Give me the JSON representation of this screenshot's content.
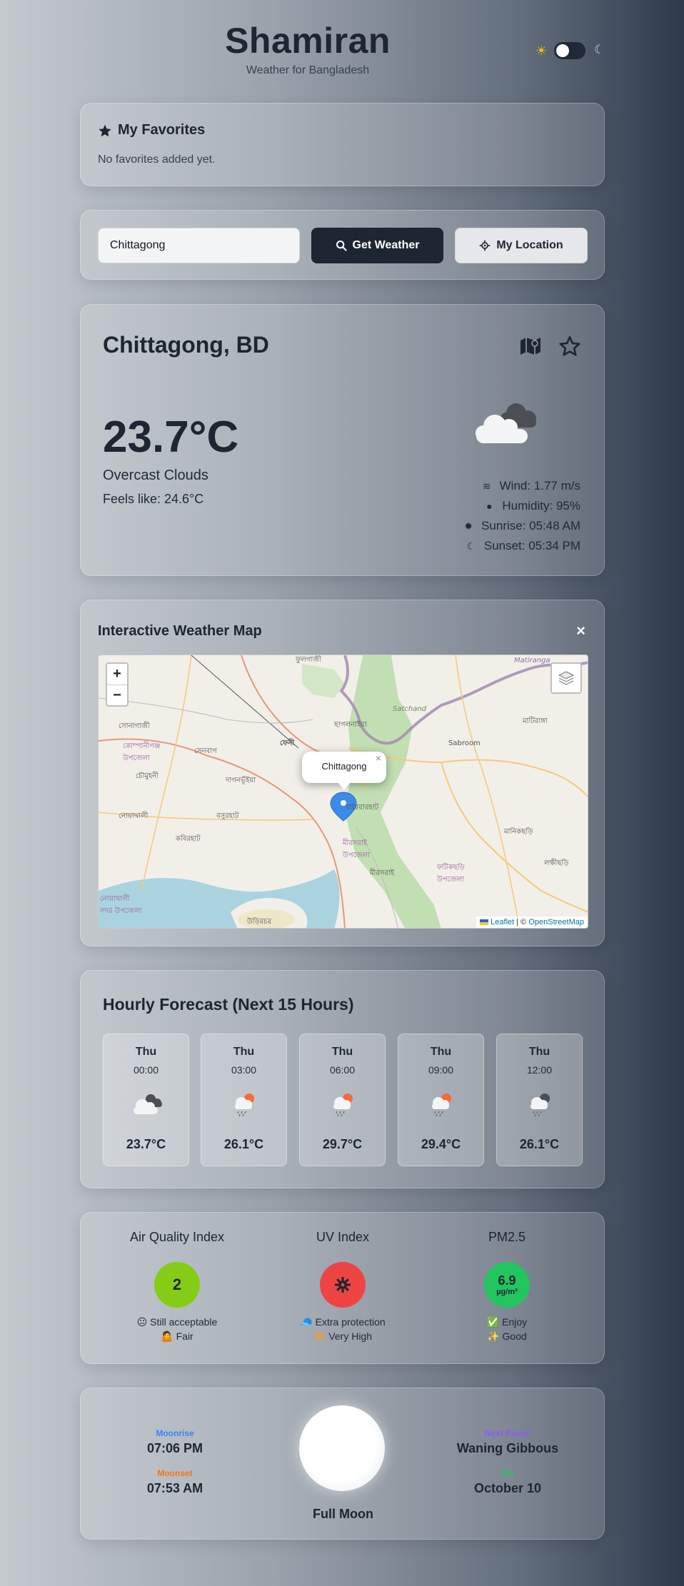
{
  "header": {
    "title": "Shamiran",
    "subtitle": "Weather for Bangladesh",
    "theme_toggle_on": false
  },
  "favorites": {
    "title": "My Favorites",
    "empty_text": "No favorites added yet."
  },
  "search": {
    "value": "Chittagong",
    "get_weather_label": "Get Weather",
    "my_location_label": "My Location"
  },
  "current": {
    "city": "Chittagong, BD",
    "temperature": "23.7°C",
    "description": "Overcast Clouds",
    "feels_like": "Feels like: 24.6°C",
    "wind": "Wind: 1.77 m/s",
    "humidity": "Humidity: 95%",
    "sunrise": "Sunrise: 05:48 AM",
    "sunset": "Sunset: 05:34 PM",
    "icon": "overcast-clouds-icon"
  },
  "map": {
    "title": "Interactive Weather Map",
    "close_label": "×",
    "zoom_in": "+",
    "zoom_out": "−",
    "popup_text": "Chittagong",
    "popup_close": "×",
    "attribution_leaflet": "Leaflet",
    "attribution_sep": " | © ",
    "attribution_osm": "OpenStreetMap",
    "labels": [
      "ফুলগাজী",
      "Matiranga",
      "সোনাগাজী",
      "ছাগলনাইয়া",
      "মাটিরাঙ্গা",
      "ফেনী",
      "Sabroom",
      "সেনবাগ",
      "কোম্পানীগঞ্জ উপজেলা",
      "চৌমুহনী",
      "দাগনভূঁইয়া",
      "নোয়াখালী",
      "বসুরহাট",
      "বারৈয়ারহাট",
      "মানিকছড়ি",
      "কবিরহাট",
      "মীরসরাই উপজেলা",
      "লক্ষীছড়ি",
      "মীরসরাই",
      "ফটিকছড়ি উপজেলা",
      "নোয়াখালী সদর উপজেলা",
      "উড়িরচর",
      "Satchand"
    ]
  },
  "hourly": {
    "title": "Hourly Forecast (Next 15 Hours)",
    "items": [
      {
        "day": "Thu",
        "time": "00:00",
        "temp": "23.7°C",
        "icon": "night-cloudy-icon"
      },
      {
        "day": "Thu",
        "time": "03:00",
        "temp": "26.1°C",
        "icon": "rain-sun-icon"
      },
      {
        "day": "Thu",
        "time": "06:00",
        "temp": "29.7°C",
        "icon": "rain-sun-icon"
      },
      {
        "day": "Thu",
        "time": "09:00",
        "temp": "29.4°C",
        "icon": "rain-sun-icon"
      },
      {
        "day": "Thu",
        "time": "12:00",
        "temp": "26.1°C",
        "icon": "rain-night-icon"
      }
    ]
  },
  "indices": {
    "aqi": {
      "title": "Air Quality Index",
      "value": "2",
      "line1": "😐 Still acceptable",
      "line2": "🤷 Fair",
      "color": "#84cc16"
    },
    "uv": {
      "title": "UV Index",
      "line1": "🧢 Extra protection",
      "line2": "🔆 Very High",
      "color": "#ef4444"
    },
    "pm25": {
      "title": "PM2.5",
      "value": "6.9",
      "unit": "µg/m³",
      "line1": "✅ Enjoy",
      "line2": "✨ Good",
      "color": "#22c55e"
    }
  },
  "moon": {
    "moonrise_label": "Moonrise",
    "moonrise": "07:06 PM",
    "moonset_label": "Moonset",
    "moonset": "07:53 AM",
    "phase": "Full Moon",
    "next_phase_label": "Next Phase",
    "next_phase": "Waning Gibbous",
    "on_label": "On",
    "on_date": "October 10",
    "colors": {
      "moonrise": "#3b82f6",
      "moonset": "#f97316",
      "next_phase": "#8b5cf6",
      "on": "#22c55e"
    }
  }
}
